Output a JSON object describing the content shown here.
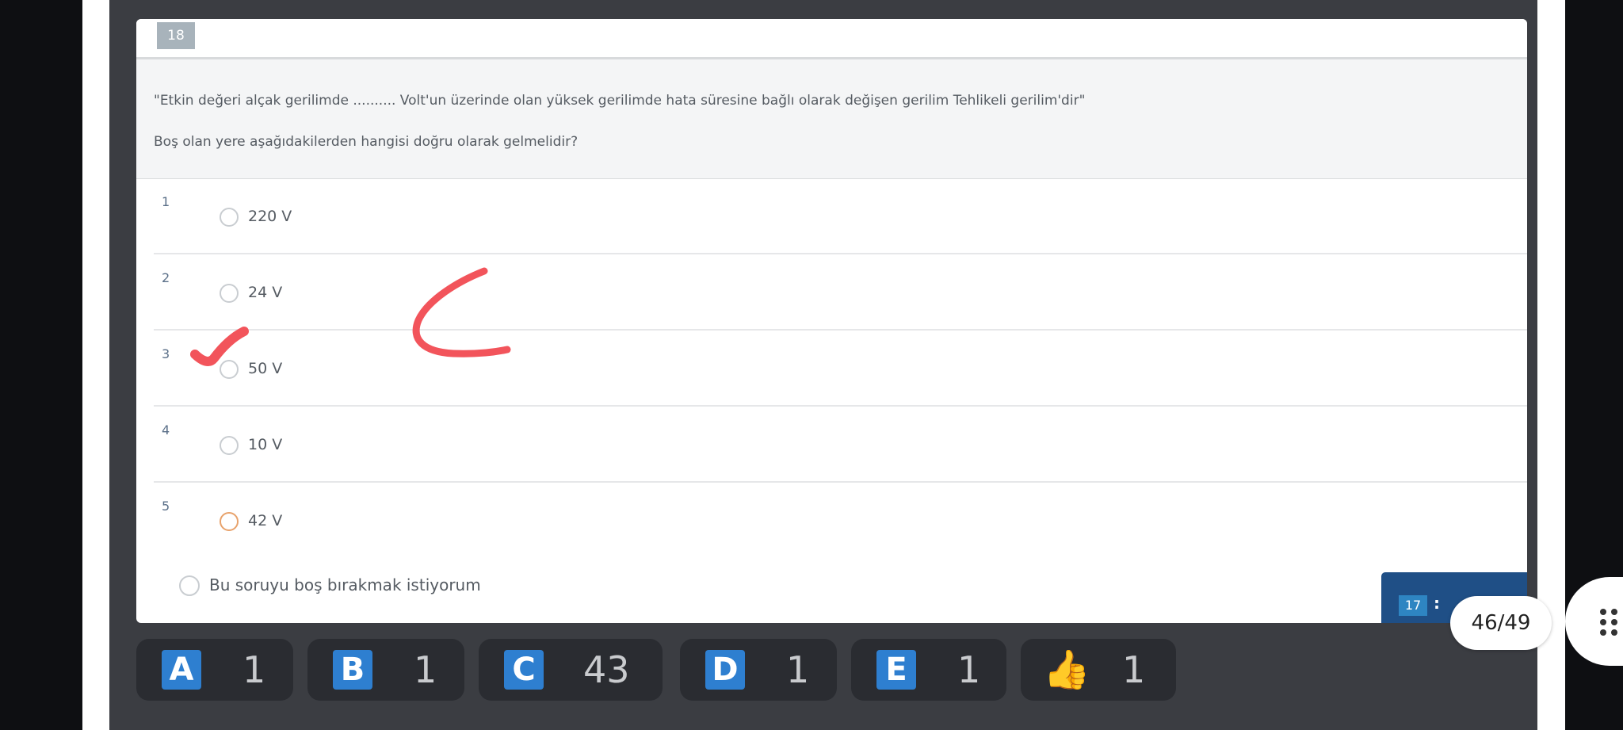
{
  "question": {
    "number": "18",
    "text": "\"Etkin değeri alçak gerilimde .......... Volt'un üzerinde olan yüksek gerilimde hata süresine bağlı olarak değişen gerilim Tehlikeli gerilim'dir\"",
    "prompt": "Boş olan yere aşağıdakilerden hangisi doğru olarak gelmelidir?"
  },
  "options": [
    {
      "num": "1",
      "label": "220 V"
    },
    {
      "num": "2",
      "label": "24 V"
    },
    {
      "num": "3",
      "label": "50 V"
    },
    {
      "num": "4",
      "label": "10 V"
    },
    {
      "num": "5",
      "label": "42 V"
    }
  ],
  "skip_label": "Bu soruyu boş bırakmak istiyorum",
  "timer": {
    "minutes": "17",
    "separator": ":"
  },
  "progress": "46/49",
  "reactions": [
    {
      "letter": "A",
      "count": "1"
    },
    {
      "letter": "B",
      "count": "1"
    },
    {
      "letter": "C",
      "count": "43"
    },
    {
      "letter": "D",
      "count": "1"
    },
    {
      "letter": "E",
      "count": "1"
    },
    {
      "icon": "thumbs-up-icon",
      "count": "1"
    }
  ],
  "colors": {
    "accent": "#2e7fd0",
    "annotation": "#f2545b",
    "selected_radio": "#e8a26b"
  }
}
